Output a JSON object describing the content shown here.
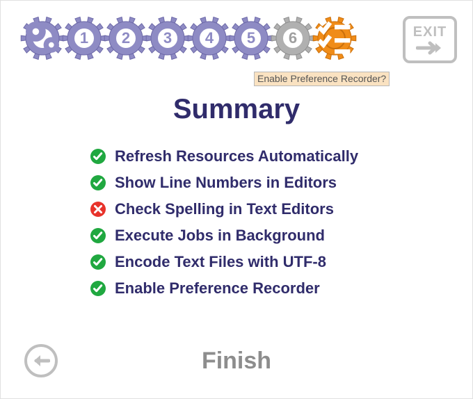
{
  "wizard": {
    "steps": [
      {
        "label": "",
        "variant": "purple",
        "icon": "settings"
      },
      {
        "label": "1",
        "variant": "purple",
        "icon": null
      },
      {
        "label": "2",
        "variant": "purple",
        "icon": null
      },
      {
        "label": "3",
        "variant": "purple",
        "icon": null
      },
      {
        "label": "4",
        "variant": "purple",
        "icon": null
      },
      {
        "label": "5",
        "variant": "purple",
        "icon": null
      },
      {
        "label": "6",
        "variant": "grey",
        "icon": null
      },
      {
        "label": "",
        "variant": "orange",
        "icon": "checklist"
      }
    ],
    "exit_label": "EXIT",
    "tooltip": "Enable Preference Recorder?"
  },
  "title": "Summary",
  "items": [
    {
      "status": "on",
      "text": "Refresh Resources Automatically"
    },
    {
      "status": "on",
      "text": "Show Line Numbers in Editors"
    },
    {
      "status": "off",
      "text": "Check Spelling in Text Editors"
    },
    {
      "status": "on",
      "text": "Execute Jobs in Background"
    },
    {
      "status": "on",
      "text": "Encode Text Files with UTF-8"
    },
    {
      "status": "on",
      "text": "Enable Preference Recorder"
    }
  ],
  "footer": {
    "finish_label": "Finish"
  },
  "colors": {
    "purple": "#8e8bc4",
    "grey": "#b0b0b0",
    "orange": "#f08c18",
    "green": "#20a840",
    "red": "#e8332b",
    "title": "#302c6b"
  }
}
